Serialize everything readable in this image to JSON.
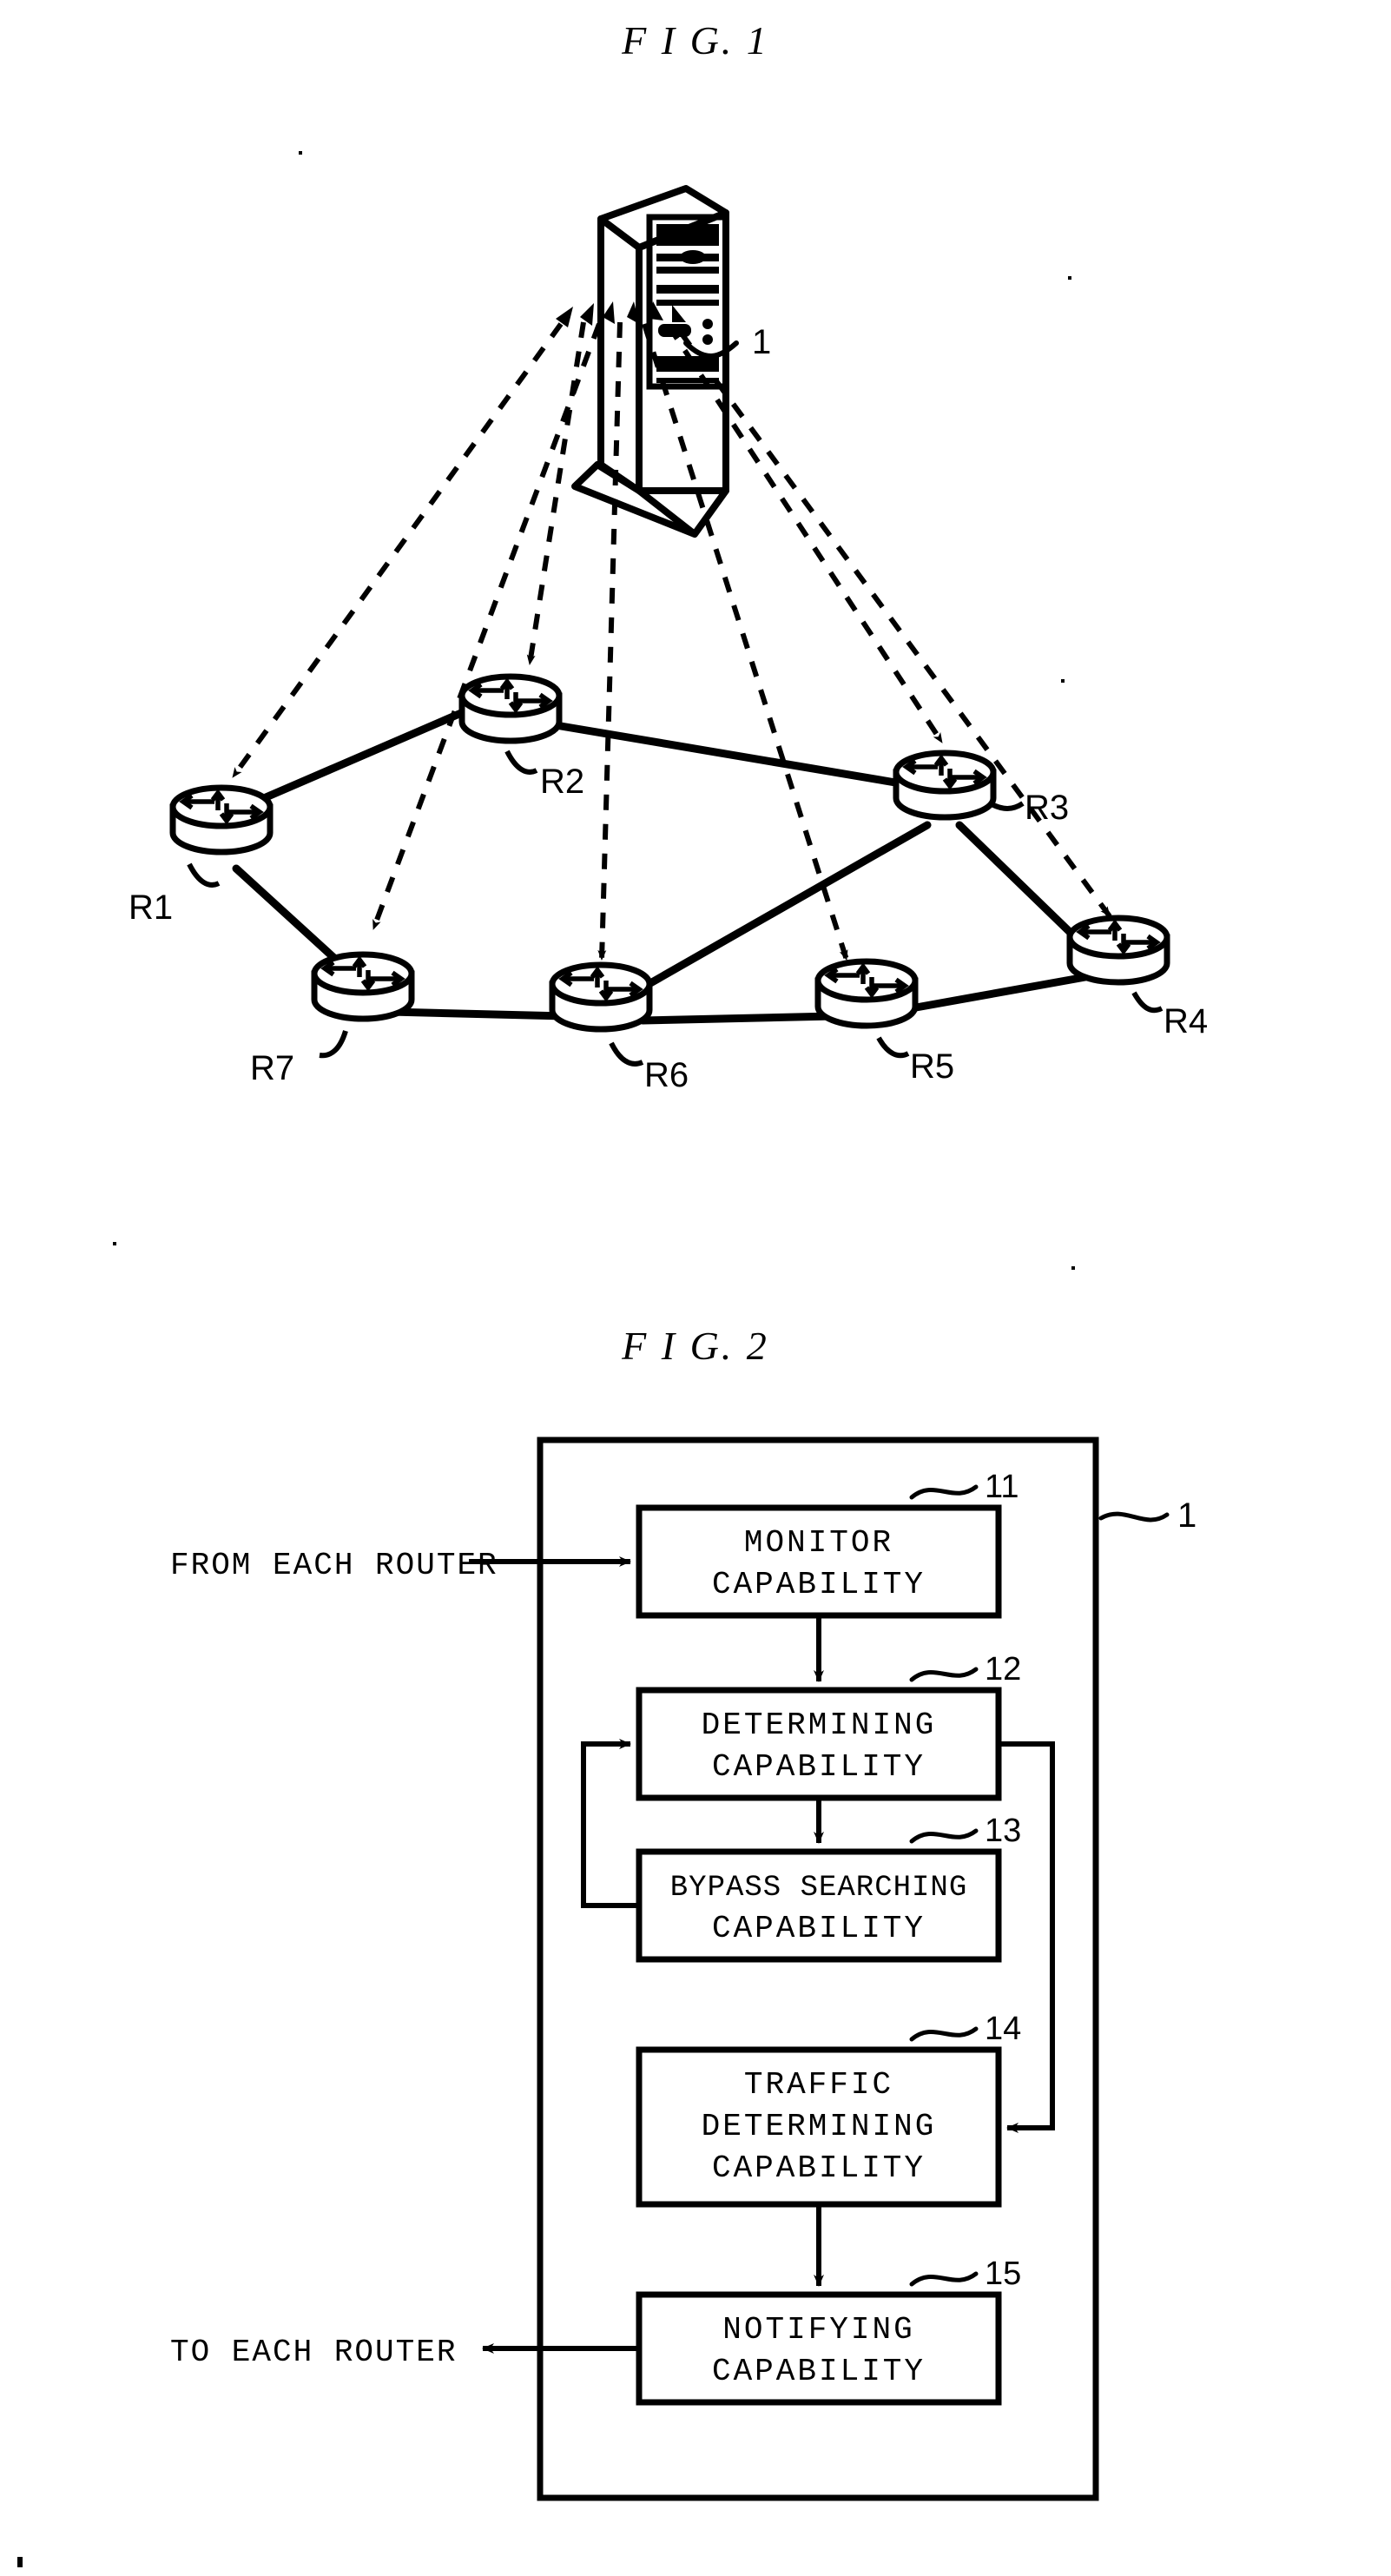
{
  "figures": [
    {
      "title": "F I G. 1",
      "type": "network-topology-diagram",
      "server": {
        "label": "1",
        "icon": "server-tower-icon"
      },
      "routers": [
        {
          "id": "R1",
          "label": "R1"
        },
        {
          "id": "R2",
          "label": "R2"
        },
        {
          "id": "R3",
          "label": "R3"
        },
        {
          "id": "R4",
          "label": "R4"
        },
        {
          "id": "R5",
          "label": "R5"
        },
        {
          "id": "R6",
          "label": "R6"
        },
        {
          "id": "R7",
          "label": "R7"
        }
      ]
    },
    {
      "title": "F I G. 2",
      "type": "block-diagram",
      "enclosure_label": "1",
      "input_label": "FROM EACH ROUTER",
      "output_label": "TO EACH ROUTER",
      "blocks": [
        {
          "ref": "11",
          "lines": [
            "MONITOR",
            "CAPABILITY"
          ]
        },
        {
          "ref": "12",
          "lines": [
            "DETERMINING",
            "CAPABILITY"
          ]
        },
        {
          "ref": "13",
          "lines": [
            "BYPASS SEARCHING",
            "CAPABILITY"
          ]
        },
        {
          "ref": "14",
          "lines": [
            "TRAFFIC",
            "DETERMINING",
            "CAPABILITY"
          ]
        },
        {
          "ref": "15",
          "lines": [
            "NOTIFYING",
            "CAPABILITY"
          ]
        }
      ]
    }
  ],
  "colors": {
    "ink": "#000000",
    "paper": "#ffffff"
  }
}
